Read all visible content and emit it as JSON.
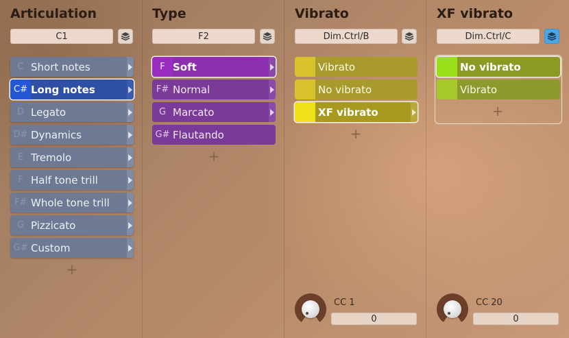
{
  "columns": {
    "articulation": {
      "title": "Articulation",
      "selector": "C1",
      "items": [
        {
          "key": "C",
          "label": "Short notes"
        },
        {
          "key": "C#",
          "label": "Long notes"
        },
        {
          "key": "D",
          "label": "Legato"
        },
        {
          "key": "D#",
          "label": "Dynamics"
        },
        {
          "key": "E",
          "label": "Tremolo"
        },
        {
          "key": "F",
          "label": "Half tone trill"
        },
        {
          "key": "F#",
          "label": "Whole tone trill"
        },
        {
          "key": "G",
          "label": "Pizzicato"
        },
        {
          "key": "G#",
          "label": "Custom"
        }
      ],
      "selected_index": 1,
      "add_label": "+"
    },
    "type": {
      "title": "Type",
      "selector": "F2",
      "items": [
        {
          "key": "F",
          "label": "Soft"
        },
        {
          "key": "F#",
          "label": "Normal"
        },
        {
          "key": "G",
          "label": "Marcato"
        },
        {
          "key": "G#",
          "label": "Flautando"
        }
      ],
      "selected_index": 0,
      "add_label": "+"
    },
    "vibrato": {
      "title": "Vibrato",
      "selector": "Dim.Ctrl/B",
      "items": [
        {
          "label": "Vibrato"
        },
        {
          "label": "No vibrato"
        },
        {
          "label": "XF vibrato"
        }
      ],
      "selected_index": 2,
      "add_label": "+",
      "cc_label": "CC 1",
      "cc_value": "0"
    },
    "xf_vibrato": {
      "title": "XF vibrato",
      "selector": "Dim.Ctrl/C",
      "items": [
        {
          "label": "No vibrato"
        },
        {
          "label": "Vibrato"
        }
      ],
      "selected_index": 0,
      "add_label": "+",
      "cc_label": "CC 20",
      "cc_value": "0"
    }
  },
  "icons": {
    "layer": "layers-icon",
    "arrow": "chevron-right-icon",
    "knob": "knob-icon"
  },
  "colors": {
    "articulation_selected": "#2457d6",
    "type_selected": "#9b2cc0",
    "vibrato_selected": "#efe21c",
    "xf_vibrato_selected": "#99e01a",
    "layer_active": "#4aa6e6"
  }
}
